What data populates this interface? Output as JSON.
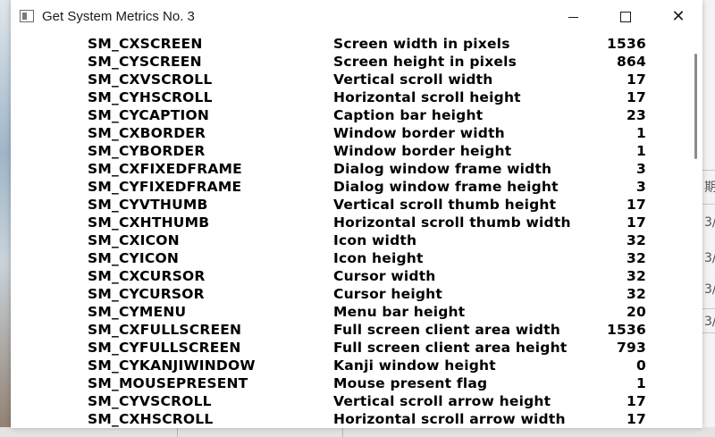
{
  "window": {
    "title": "Get System Metrics No. 3",
    "controls": {
      "minimize": "minimize-icon",
      "maximize": "maximize-icon",
      "close": "close-icon"
    }
  },
  "metrics": [
    {
      "name": "SM_CXSCREEN",
      "desc": "Screen width in pixels",
      "value": "1536"
    },
    {
      "name": "SM_CYSCREEN",
      "desc": "Screen height in pixels",
      "value": "864"
    },
    {
      "name": "SM_CXVSCROLL",
      "desc": "Vertical scroll width",
      "value": "17"
    },
    {
      "name": "SM_CYHSCROLL",
      "desc": "Horizontal scroll height",
      "value": "17"
    },
    {
      "name": "SM_CYCAPTION",
      "desc": "Caption bar height",
      "value": "23"
    },
    {
      "name": "SM_CXBORDER",
      "desc": "Window border width",
      "value": "1"
    },
    {
      "name": "SM_CYBORDER",
      "desc": "Window border height",
      "value": "1"
    },
    {
      "name": "SM_CXFIXEDFRAME",
      "desc": "Dialog window frame width",
      "value": "3"
    },
    {
      "name": "SM_CYFIXEDFRAME",
      "desc": "Dialog window frame height",
      "value": "3"
    },
    {
      "name": "SM_CYVTHUMB",
      "desc": "Vertical scroll thumb height",
      "value": "17"
    },
    {
      "name": "SM_CXHTHUMB",
      "desc": "Horizontal scroll thumb width",
      "value": "17"
    },
    {
      "name": "SM_CXICON",
      "desc": "Icon width",
      "value": "32"
    },
    {
      "name": "SM_CYICON",
      "desc": "Icon height",
      "value": "32"
    },
    {
      "name": "SM_CXCURSOR",
      "desc": "Cursor width",
      "value": "32"
    },
    {
      "name": "SM_CYCURSOR",
      "desc": "Cursor height",
      "value": "32"
    },
    {
      "name": "SM_CYMENU",
      "desc": "Menu bar height",
      "value": "20"
    },
    {
      "name": "SM_CXFULLSCREEN",
      "desc": "Full screen client area width",
      "value": "1536"
    },
    {
      "name": "SM_CYFULLSCREEN",
      "desc": "Full screen client area height",
      "value": "793"
    },
    {
      "name": "SM_CYKANJIWINDOW",
      "desc": "Kanji window height",
      "value": "0"
    },
    {
      "name": "SM_MOUSEPRESENT",
      "desc": "Mouse present flag",
      "value": "1"
    },
    {
      "name": "SM_CYVSCROLL",
      "desc": "Vertical scroll arrow height",
      "value": "17"
    },
    {
      "name": "SM_CXHSCROLL",
      "desc": "Horizontal scroll arrow width",
      "value": "17"
    }
  ],
  "scroll": {
    "position_fraction": 0.0
  },
  "background": {
    "fragments": [
      "期",
      "3/",
      "3/",
      "3/",
      "3/"
    ]
  }
}
